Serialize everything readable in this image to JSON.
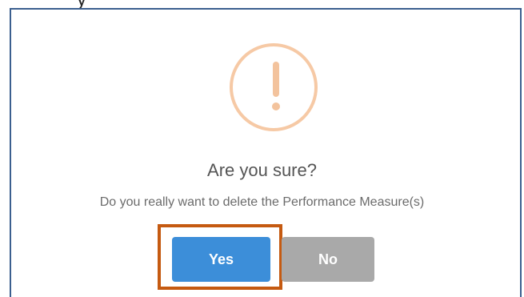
{
  "dialog": {
    "cut_text": "y",
    "icon": "exclamation-circle-icon",
    "icon_color": "#f6c9a5",
    "title": "Are you sure?",
    "message": "Do you really want to delete the Performance Measure(s)",
    "yes_label": "Yes",
    "no_label": "No",
    "yes_color": "#3c8ed9",
    "no_color": "#a9a9a9",
    "highlight_color": "#c55a11"
  }
}
